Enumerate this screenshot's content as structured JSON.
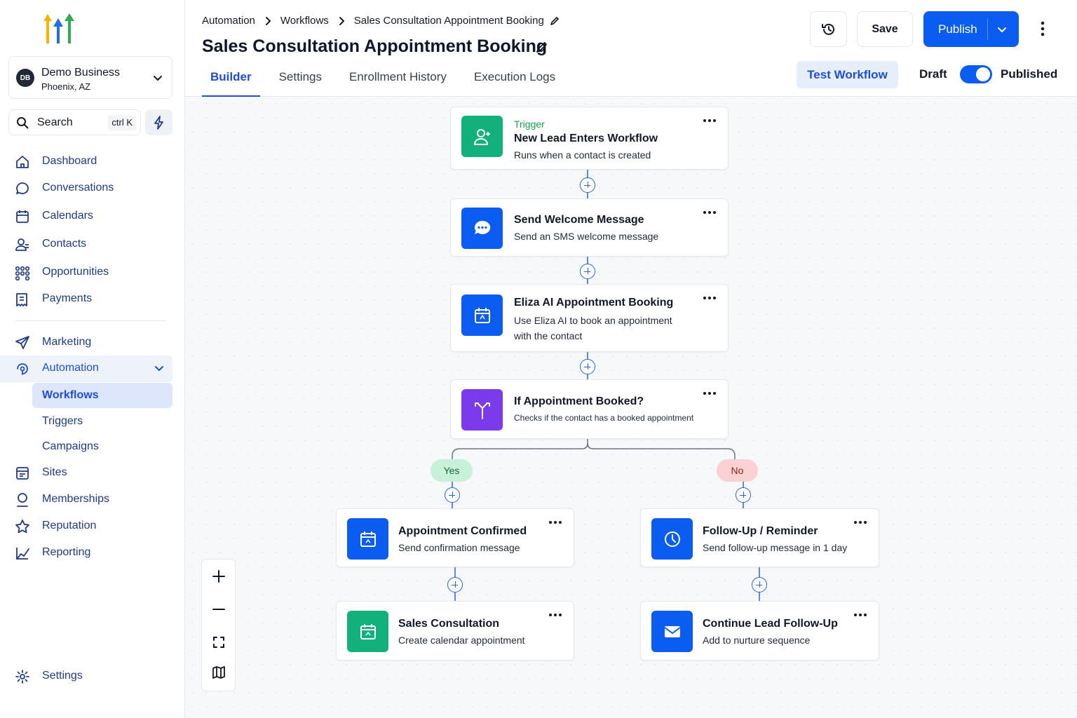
{
  "business": {
    "initials": "DB",
    "name": "Demo Business",
    "location": "Phoenix, AZ"
  },
  "search": {
    "label": "Search",
    "shortcut": "ctrl K"
  },
  "nav": {
    "dashboard": "Dashboard",
    "conversations": "Conversations",
    "calendars": "Calendars",
    "contacts": "Contacts",
    "opportunities": "Opportunities",
    "payments": "Payments",
    "marketing": "Marketing",
    "automation": "Automation",
    "workflows": "Workflows",
    "triggers": "Triggers",
    "campaigns": "Campaigns",
    "sites": "Sites",
    "memberships": "Memberships",
    "reputation": "Reputation",
    "reporting": "Reporting",
    "settings": "Settings"
  },
  "breadcrumb": {
    "level1": "Automation",
    "level2": "Workflows",
    "level3": "Sales Consultation Appointment Booking"
  },
  "page": {
    "title": "Sales Consultation Appointment Booking"
  },
  "tabs": {
    "builder": "Builder",
    "settings": "Settings",
    "enrollment": "Enrollment History",
    "logs": "Execution Logs"
  },
  "actions": {
    "save": "Save",
    "publish": "Publish",
    "test": "Test Workflow",
    "draft": "Draft",
    "published": "Published"
  },
  "colors": {
    "accent": "#0b5cf0",
    "green": "#12b07b",
    "purple": "#7c3aed"
  },
  "nodes": {
    "trigger": {
      "kicker": "Trigger",
      "title": "New Lead Enters Workflow",
      "desc": "Runs when a contact is created",
      "icon": "user-plus-icon"
    },
    "welcome": {
      "title": "Send Welcome Message",
      "desc": "Send an SMS welcome message",
      "icon": "chat-bubble-icon"
    },
    "eliza": {
      "title": "Eliza AI Appointment Booking",
      "desc_line1": "Use Eliza AI to book an appointment",
      "desc_line2": "with the contact",
      "icon": "calendar-ai-icon"
    },
    "condition": {
      "title": "If Appointment Booked?",
      "desc": "Checks if the contact has a booked appointment",
      "icon": "split-branch-icon"
    },
    "confirmed": {
      "title": "Appointment Confirmed",
      "desc": "Send confirmation message",
      "icon": "calendar-icon"
    },
    "followup": {
      "title": "Follow-Up / Reminder",
      "desc": "Send follow-up message in 1 day",
      "icon": "clock-icon"
    },
    "consult": {
      "title": "Sales Consultation",
      "desc": "Create calendar appointment",
      "icon": "calendar-icon"
    },
    "nurture": {
      "title": "Continue Lead Follow-Up",
      "desc": "Add to nurture sequence",
      "icon": "mail-icon"
    }
  },
  "branches": {
    "yes": "Yes",
    "no": "No"
  }
}
